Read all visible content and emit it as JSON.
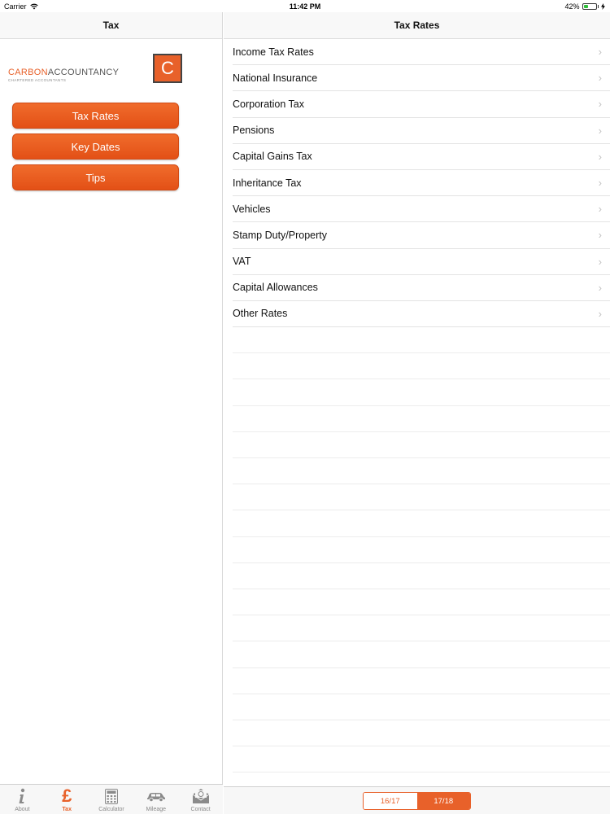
{
  "status": {
    "carrier": "Carrier",
    "time": "11:42 PM",
    "battery": "42%",
    "battery_level": 0.42
  },
  "left": {
    "title": "Tax",
    "logo": {
      "word1": "CARBON",
      "word2": "ACCOUNTANCY",
      "tagline": "CHARTERED ACCOUNTANTS",
      "badge": "C"
    },
    "buttons": [
      "Tax Rates",
      "Key Dates",
      "Tips"
    ]
  },
  "right": {
    "title": "Tax Rates",
    "items": [
      "Income Tax Rates",
      "National Insurance",
      "Corporation Tax",
      "Pensions",
      "Capital Gains Tax",
      "Inheritance Tax",
      "Vehicles",
      "Stamp Duty/Property",
      "VAT",
      "Capital Allowances",
      "Other Rates"
    ]
  },
  "tabs": [
    {
      "label": "About",
      "icon": "info-icon"
    },
    {
      "label": "Tax",
      "icon": "pound-icon",
      "active": true
    },
    {
      "label": "Calculator",
      "icon": "calculator-icon"
    },
    {
      "label": "Mileage",
      "icon": "car-icon"
    },
    {
      "label": "Contact",
      "icon": "contact-icon"
    }
  ],
  "segments": {
    "options": [
      "16/17",
      "17/18"
    ],
    "selected": "17/18"
  },
  "colors": {
    "accent": "#e8612a"
  }
}
